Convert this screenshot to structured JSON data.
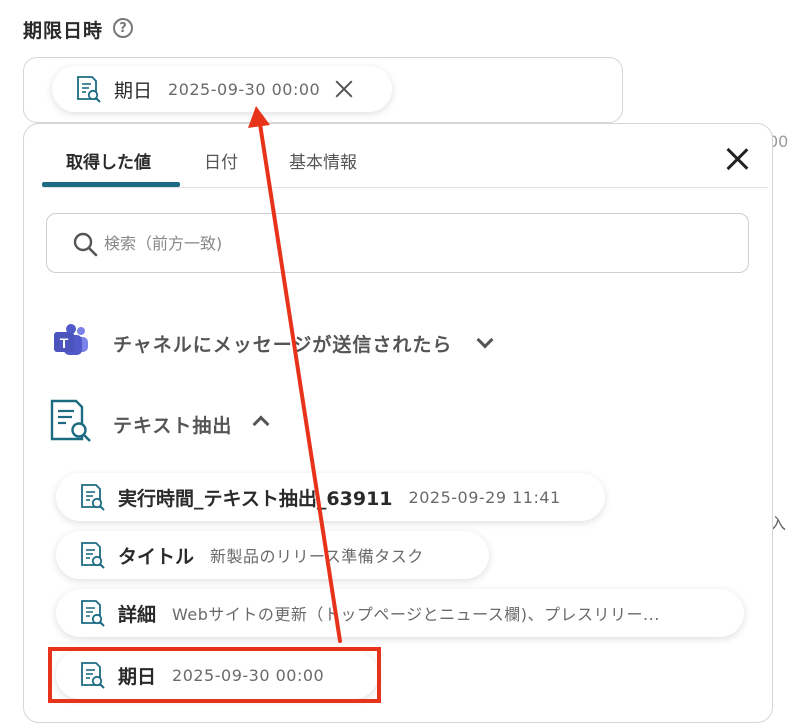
{
  "field": {
    "label": "期限日時",
    "help_icon": "question-circle-icon",
    "help_glyph": "?"
  },
  "selected_chip": {
    "name": "期日",
    "value": "2025-09-30 00:00",
    "icon": "document-search-icon"
  },
  "background": {
    "cut_text_1": "00",
    "cut_text_2": "入"
  },
  "tabs": [
    {
      "label": "取得した値",
      "active": true
    },
    {
      "label": "日付",
      "active": false
    },
    {
      "label": "基本情報",
      "active": false
    }
  ],
  "search": {
    "placeholder": "検索（前方一致)"
  },
  "sections": {
    "teams": {
      "title": "チャネルにメッセージが送信されたら",
      "icon": "microsoft-teams-icon",
      "expanded": false
    },
    "extract": {
      "title": "テキスト抽出",
      "icon": "document-search-icon",
      "expanded": true
    }
  },
  "items": [
    {
      "name": "実行時間_テキスト抽出_63911",
      "value": "2025-09-29 11:41"
    },
    {
      "name": "タイトル",
      "value": "新製品のリリース準備タスク"
    },
    {
      "name": "詳細",
      "value": "Webサイトの更新（トップページとニュース欄)、プレスリリー..."
    },
    {
      "name": "期日",
      "value": "2025-09-30 00:00"
    }
  ],
  "colors": {
    "accent": "#1d6b83",
    "highlight": "#e8331b",
    "teams_purple": "#5059c9"
  }
}
